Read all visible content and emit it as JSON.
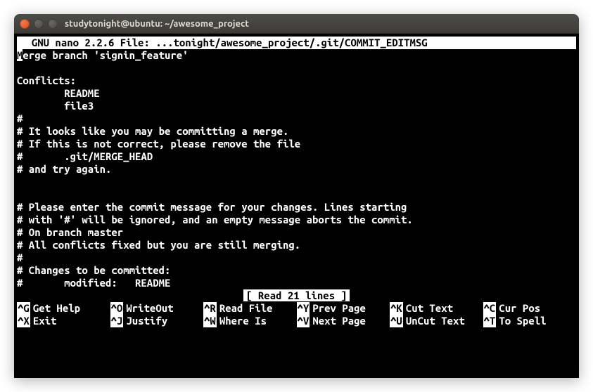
{
  "window": {
    "title": "studytonight@ubuntu: ~/awesome_project"
  },
  "nano": {
    "app": "GNU nano",
    "version": "2.2.6",
    "file_label": "File:",
    "file_path": "...tonight/awesome_project/.git/COMMIT_EDITMSG"
  },
  "editor": {
    "lines": [
      "Merge branch 'signin_feature'",
      "",
      "Conflicts:",
      "        README",
      "        file3",
      "#",
      "# It looks like you may be committing a merge.",
      "# If this is not correct, please remove the file",
      "#       .git/MERGE_HEAD",
      "# and try again.",
      "",
      "",
      "# Please enter the commit message for your changes. Lines starting",
      "# with '#' will be ignored, and an empty message aborts the commit.",
      "# On branch master",
      "# All conflicts fixed but you are still merging.",
      "#",
      "# Changes to be committed:",
      "#       modified:   README"
    ],
    "cursor_line": 0,
    "cursor_col": 0
  },
  "status": {
    "message": "[ Read 21 lines ]"
  },
  "shortcuts": {
    "row1": [
      {
        "key": "^G",
        "label": "Get Help"
      },
      {
        "key": "^O",
        "label": "WriteOut"
      },
      {
        "key": "^R",
        "label": "Read File"
      },
      {
        "key": "^Y",
        "label": "Prev Page"
      },
      {
        "key": "^K",
        "label": "Cut Text"
      },
      {
        "key": "^C",
        "label": "Cur Pos"
      }
    ],
    "row2": [
      {
        "key": "^X",
        "label": "Exit"
      },
      {
        "key": "^J",
        "label": "Justify"
      },
      {
        "key": "^W",
        "label": "Where Is"
      },
      {
        "key": "^V",
        "label": "Next Page"
      },
      {
        "key": "^U",
        "label": "UnCut Text"
      },
      {
        "key": "^T",
        "label": "To Spell"
      }
    ]
  }
}
